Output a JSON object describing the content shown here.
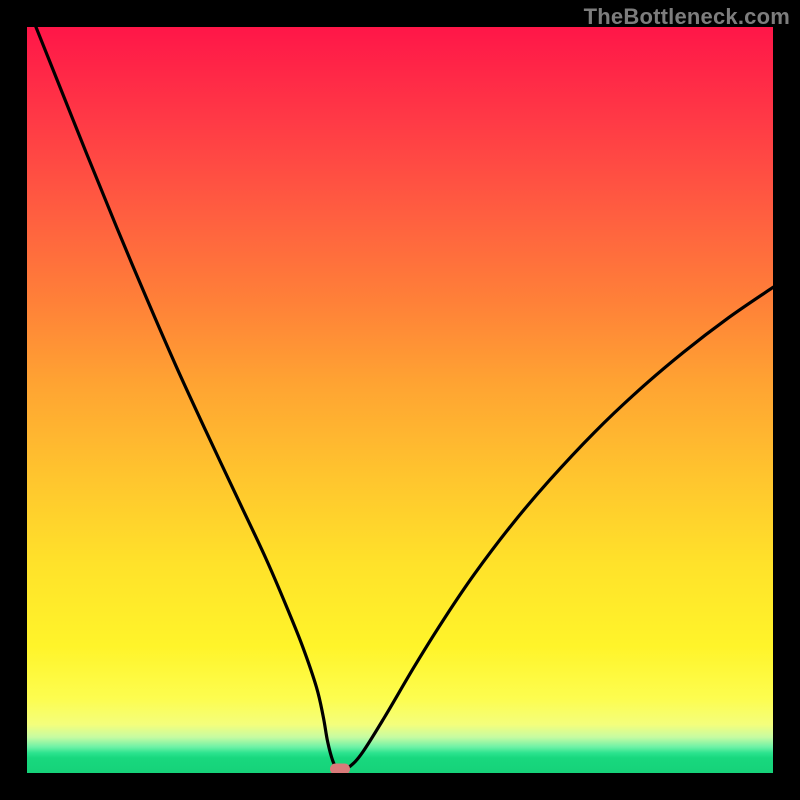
{
  "watermark": "TheBottleneck.com",
  "chart_data": {
    "type": "line",
    "title": "",
    "xlabel": "",
    "ylabel": "",
    "xlim": [
      0,
      100
    ],
    "ylim": [
      0,
      100
    ],
    "grid": false,
    "legend": false,
    "series": [
      {
        "name": "bottleneck-curve",
        "x": [
          0,
          2,
          5,
          8,
          12,
          16,
          20,
          24,
          28,
          32,
          35,
          37,
          38.8,
          39.7,
          40.3,
          41,
          41.6,
          42.3,
          43.3,
          45,
          48,
          52,
          56,
          60,
          65,
          70,
          76,
          82,
          88,
          94,
          100
        ],
        "y": [
          103,
          98,
          90.5,
          83,
          73.2,
          63.7,
          54.5,
          45.8,
          37.3,
          28.8,
          21.8,
          16.8,
          11.5,
          7.6,
          4.2,
          1.6,
          0.6,
          0.6,
          0.9,
          2.8,
          7.6,
          14.4,
          20.8,
          26.7,
          33.3,
          39.2,
          45.6,
          51.3,
          56.4,
          61.0,
          65.1
        ]
      }
    ],
    "marker": {
      "name": "sweet-spot-marker",
      "x": 42,
      "y": 0.6,
      "color": "#d97a7a"
    },
    "background": {
      "type": "vertical-gradient",
      "stops": [
        {
          "pos": 0,
          "color": "#ff1648"
        },
        {
          "pos": 0.48,
          "color": "#ffa432"
        },
        {
          "pos": 0.83,
          "color": "#fff42a"
        },
        {
          "pos": 1.0,
          "color": "#16d279"
        }
      ]
    }
  },
  "colors": {
    "frame": "#000000",
    "curve": "#000000",
    "marker": "#d97a7a",
    "watermark": "#7d7d7d"
  }
}
